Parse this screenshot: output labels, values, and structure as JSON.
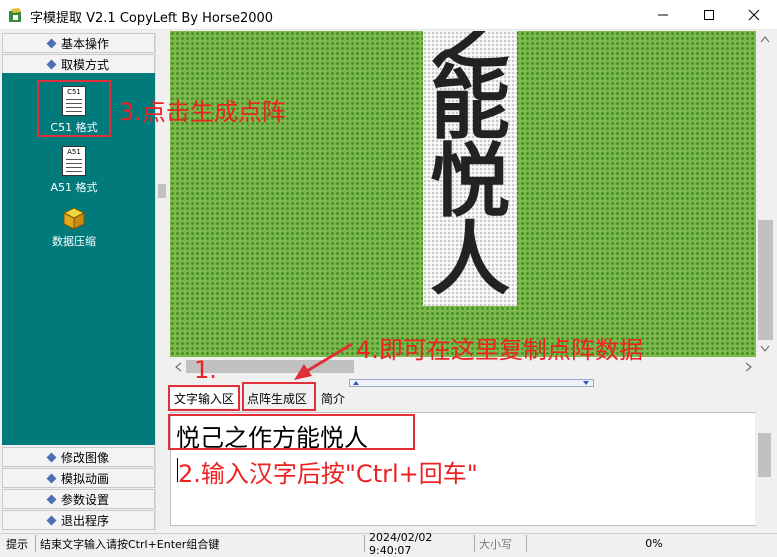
{
  "window": {
    "title": "字模提取 V2.1   CopyLeft By Horse2000",
    "app_icon": "app-icon",
    "minimize_icon": "minimize-icon",
    "maximize_icon": "maximize-icon",
    "close_icon": "close-icon"
  },
  "sidebar": {
    "top_items": [
      {
        "label": "基本操作",
        "icon": "diamond-icon"
      },
      {
        "label": "取模方式",
        "icon": "diamond-icon"
      }
    ],
    "tools": [
      {
        "label": "C51 格式",
        "icon_text": "C51",
        "icon": "c51-format-icon"
      },
      {
        "label": "A51 格式",
        "icon_text": "A51",
        "icon": "a51-format-icon"
      },
      {
        "label": "数据压缩",
        "icon": "compress-cube-icon"
      }
    ],
    "bottom_items": [
      {
        "label": "修改图像",
        "icon": "diamond-icon"
      },
      {
        "label": "模拟动画",
        "icon": "diamond-icon"
      },
      {
        "label": "参数设置",
        "icon": "diamond-icon"
      },
      {
        "label": "退出程序",
        "icon": "diamond-icon"
      }
    ]
  },
  "matrix": {
    "chars": [
      "之",
      "能",
      "悦",
      "人"
    ],
    "colors": {
      "background": "#7fb94e",
      "grid": "#fafafa",
      "dot_on": "#222222"
    }
  },
  "tabs": [
    {
      "label": "文字输入区",
      "active": true
    },
    {
      "label": "点阵生成区",
      "active": false
    },
    {
      "label": "简介",
      "active": false
    }
  ],
  "input": {
    "value": "悦己之作方能悦人"
  },
  "annotations": {
    "step1": "1.",
    "step2": "2.输入汉字后按\"Ctrl+回车\"",
    "step3": "3.点击生成点阵",
    "step4": "4.即可在这里复制点阵数据",
    "color": "#e0303a"
  },
  "status": {
    "hint_label": "提示",
    "hint_text": "结束文字输入请按Ctrl+Enter组合键",
    "datetime": "2024/02/02 9:40:07",
    "size_label": "大小写",
    "progress": "0%"
  }
}
